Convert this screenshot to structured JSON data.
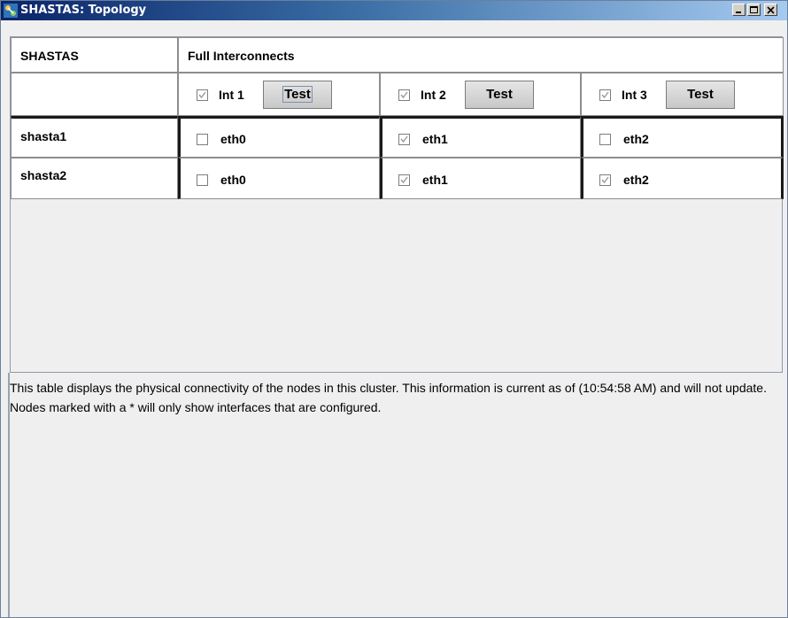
{
  "window": {
    "title": "SHASTAS: Topology",
    "controls": [
      "minimize-icon",
      "maximize-icon",
      "close-icon"
    ]
  },
  "table": {
    "corner_header": "SHASTAS",
    "group_header": "Full Interconnects",
    "interconnects": [
      {
        "label": "Int 1",
        "checked": true,
        "button": "Test"
      },
      {
        "label": "Int 2",
        "checked": true,
        "button": "Test"
      },
      {
        "label": "Int 3",
        "checked": true,
        "button": "Test"
      }
    ],
    "rows": [
      {
        "node": "shasta1",
        "cells": [
          {
            "label": "eth0",
            "checked": false
          },
          {
            "label": "eth1",
            "checked": true
          },
          {
            "label": "eth2",
            "checked": false
          }
        ]
      },
      {
        "node": "shasta2",
        "cells": [
          {
            "label": "eth0",
            "checked": false
          },
          {
            "label": "eth1",
            "checked": true
          },
          {
            "label": "eth2",
            "checked": true
          }
        ]
      }
    ]
  },
  "description": "This table displays the physical connectivity of the nodes in this cluster.  This information is current as of (10:54:58 AM) and will not update.  Nodes marked with a * will only show interfaces that are configured.",
  "colors": {
    "title_bar_start": "#0a246a",
    "title_bar_end": "#a6caf0",
    "panel_bg": "#efefef"
  }
}
